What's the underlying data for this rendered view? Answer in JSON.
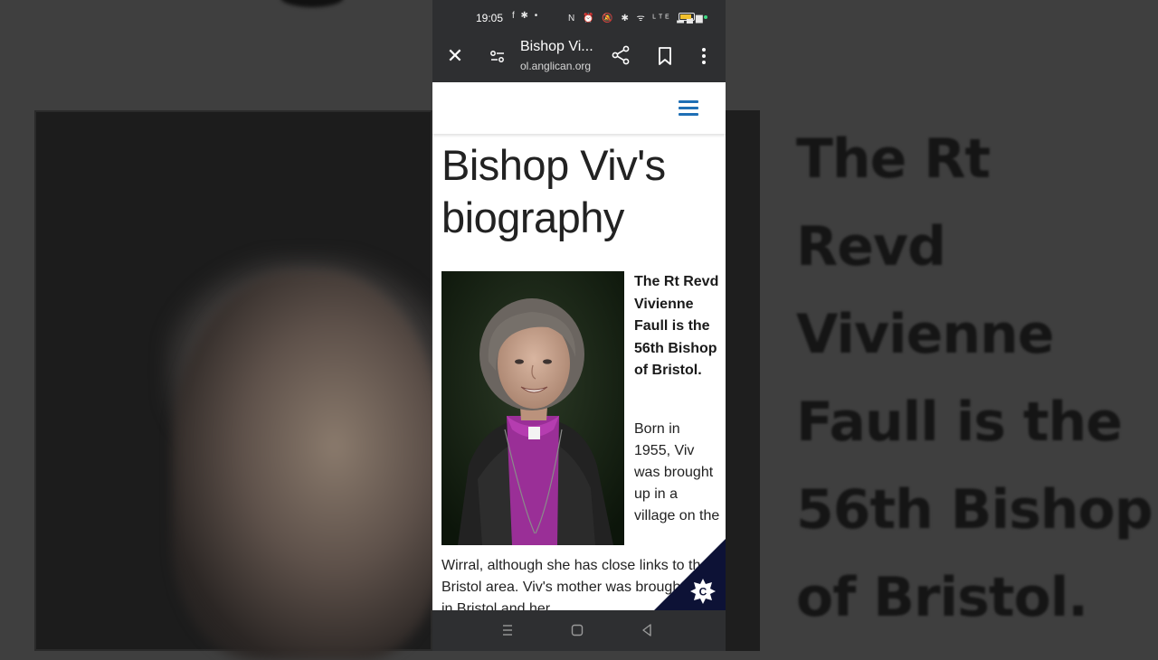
{
  "status_bar": {
    "time": "19:05",
    "notification_icons": "f ✱ •",
    "system_icons": "N ⏰ 🔕 ✱ ᯤ ᴸᵀᴱ ▂▄▆",
    "battery_level": 0.85
  },
  "browser": {
    "tab_title": "Bishop Vi...",
    "url": "ol.anglican.org"
  },
  "article": {
    "title_line1": "Bishop Viv's",
    "title_line2": "biography",
    "lead": "The Rt Revd Vivienne Faull is the 56th Bishop of Bristol.",
    "body_side": "Born in 1955, Viv was brought up in a village on the",
    "body_full": "Wirral, although she has close links to the Bristol area. Viv's mother was brought up in Bristol and her"
  },
  "background": {
    "blurred_lines": [
      "The Rt",
      "Revd",
      "Vivienne",
      "Faull is the",
      "56th Bishop",
      "of Bristol."
    ]
  },
  "colors": {
    "accent": "#1f6fb5",
    "chrome": "#2e2f31",
    "cookie_badge": "#0d1236"
  }
}
